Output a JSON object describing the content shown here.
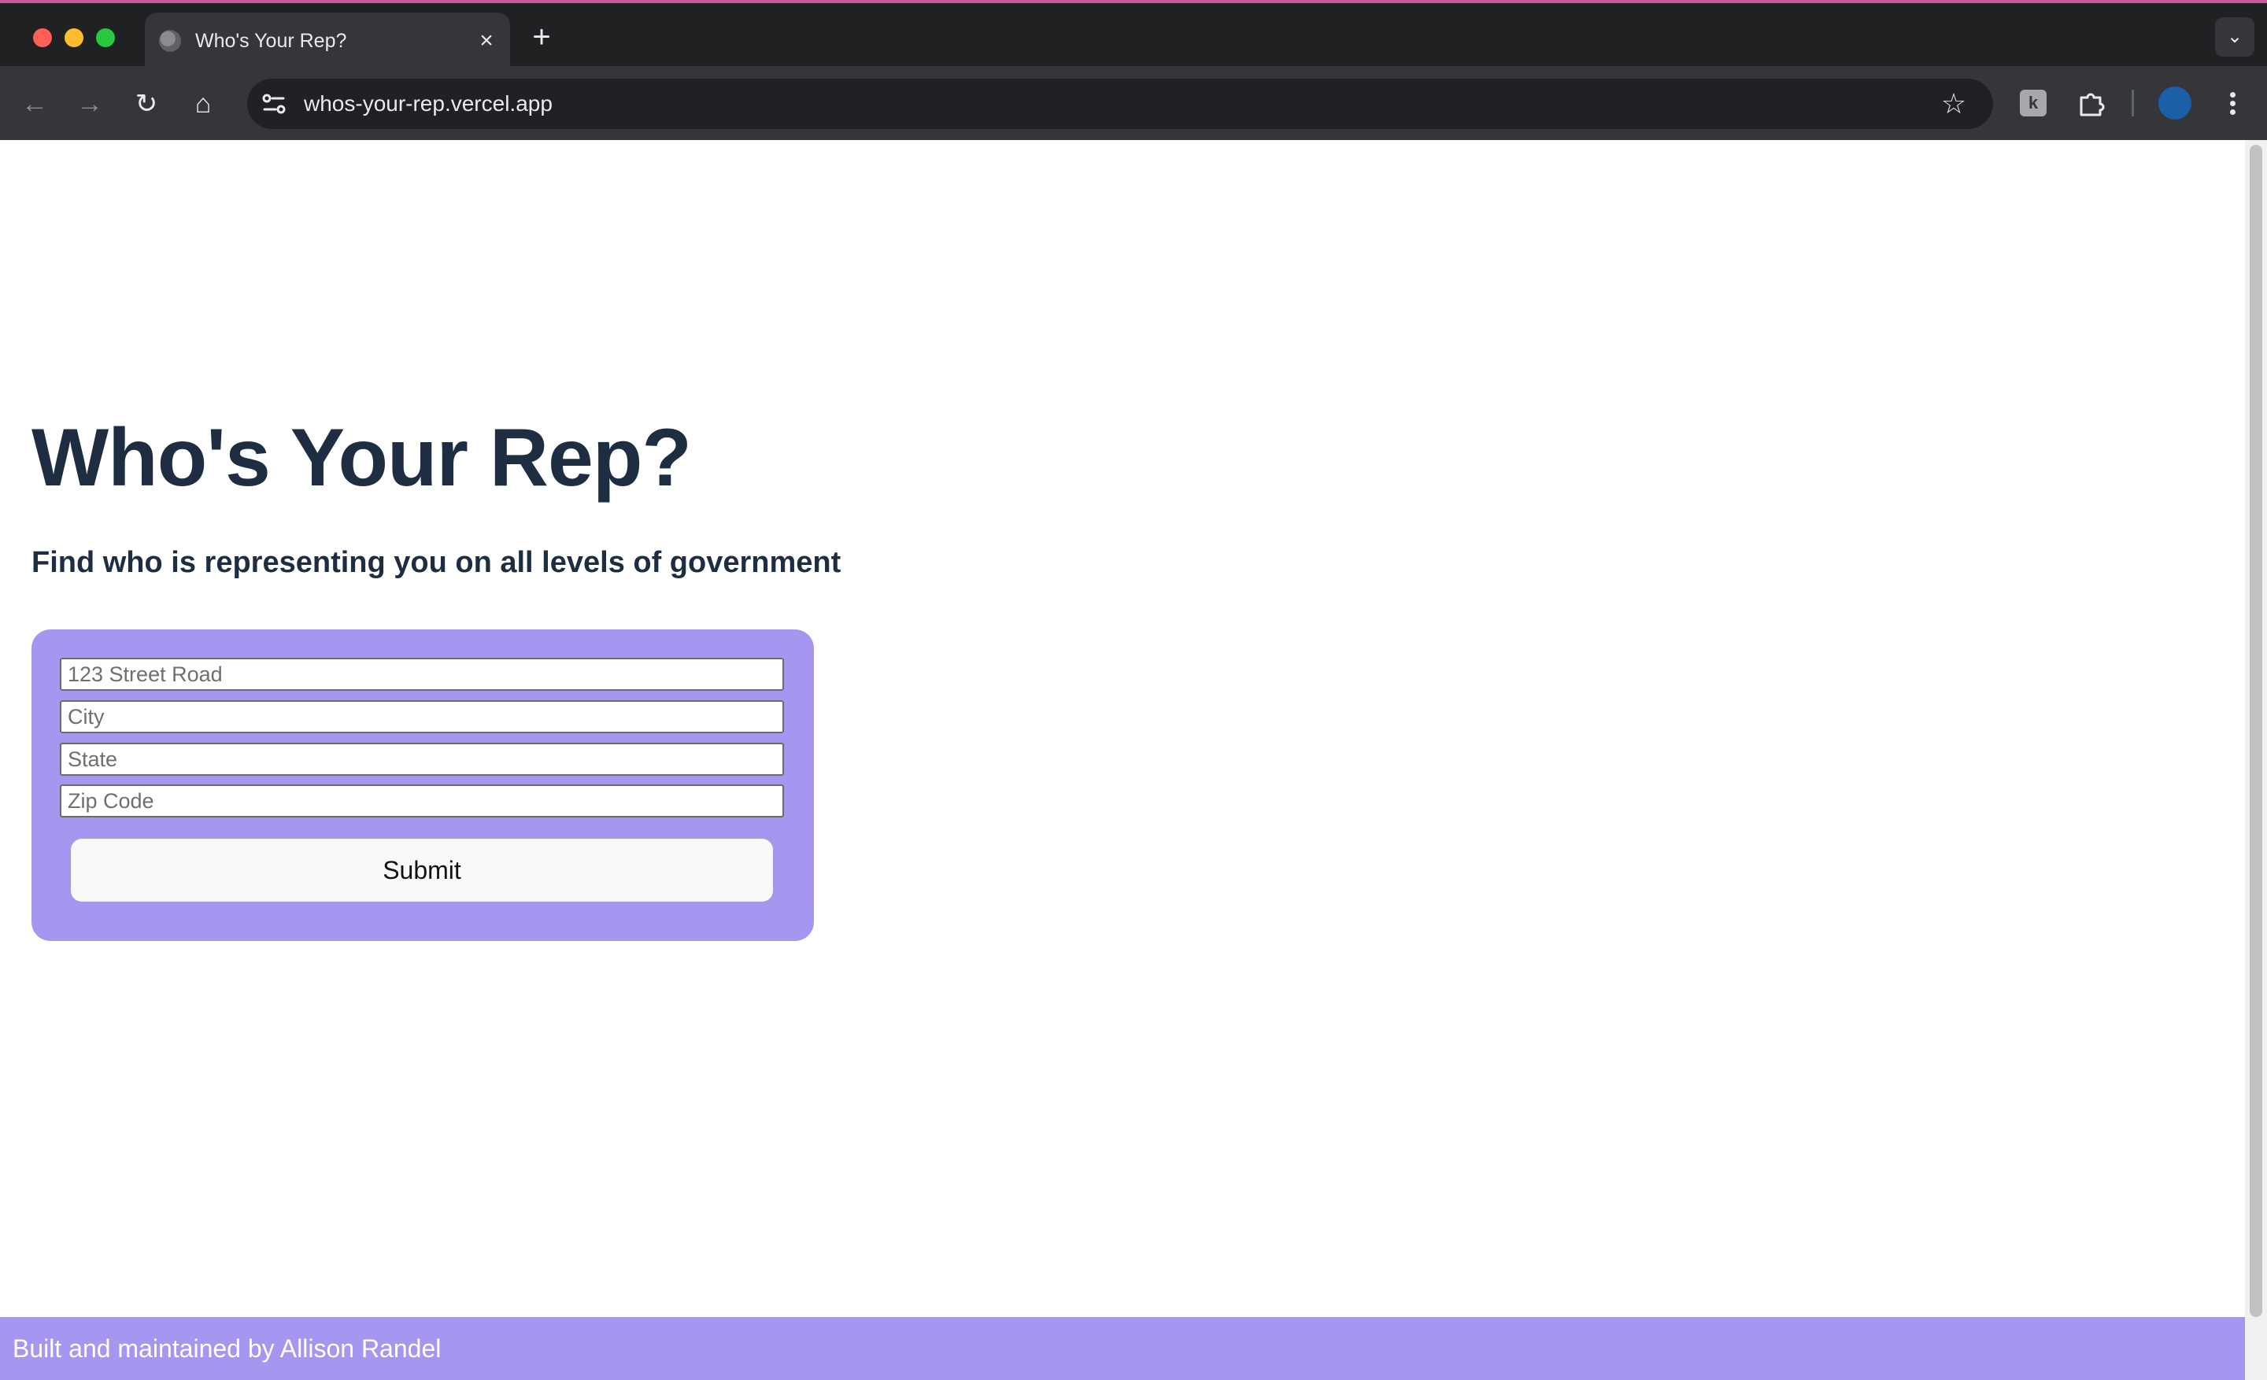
{
  "browser": {
    "tab": {
      "title": "Who's Your Rep?",
      "close_glyph": "×",
      "favicon": "globe-icon"
    },
    "new_tab_glyph": "+",
    "tab_search_glyph": "⌄",
    "nav": {
      "back_glyph": "←",
      "forward_glyph": "→",
      "reload_glyph": "↻",
      "home_glyph": "⌂"
    },
    "address_bar": {
      "url": "whos-your-rep.vercel.app"
    },
    "bookmark_glyph": "☆",
    "extension_glyph": "k"
  },
  "page": {
    "title": "Who's Your Rep?",
    "subtitle": "Find who is representing you on all levels of government",
    "form": {
      "street_placeholder": "123 Street Road",
      "city_placeholder": "City",
      "state_placeholder": "State",
      "zip_placeholder": "Zip Code",
      "submit_label": "Submit"
    },
    "footer": {
      "text": "Built and maintained by Allison Randel"
    }
  },
  "colors": {
    "accent": "#a597f0",
    "heading": "#1e2d42",
    "chrome_dark": "#1f2123",
    "chrome_toolbar": "#35363a",
    "profile": "#1a5fa8"
  }
}
